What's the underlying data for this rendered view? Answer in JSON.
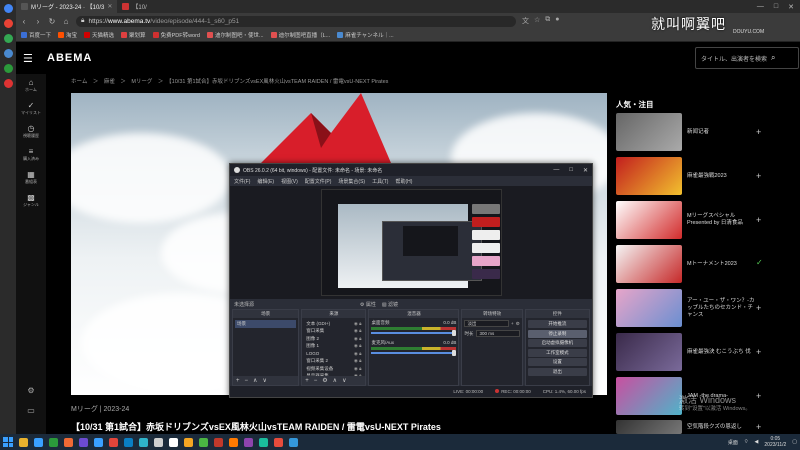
{
  "browser": {
    "tabs": [
      {
        "title": "Mリーグ - 2023-24 · 【10/3",
        "active": true,
        "favicon_color": "#333333"
      },
      {
        "title": "【10/",
        "active": false,
        "favicon_color": "#cc3333"
      }
    ],
    "url": {
      "scheme": "https://",
      "host": "www.abema.tv",
      "path": "/video/episode/444-1_s60_p51"
    },
    "window_controls": [
      "—",
      "□",
      "✕"
    ],
    "bookmarks": [
      {
        "label": "百度一下",
        "color": "#3b6fd6"
      },
      {
        "label": "淘宝",
        "color": "#ff5000"
      },
      {
        "label": "天猫精选",
        "color": "#d00000"
      },
      {
        "label": "聚划算",
        "color": "#e04040"
      },
      {
        "label": "免费PDF转word",
        "color": "#d03030"
      },
      {
        "label": "迪尔制图吧・使世...",
        "color": "#e05050"
      },
      {
        "label": "迪尔制图吧直播（L...",
        "color": "#e05050"
      },
      {
        "label": "麻雀チャンネル｜...",
        "color": "#4a8ad0"
      }
    ]
  },
  "watermark": {
    "text": "就叫啊翼吧",
    "sub": "DOUYU.COM"
  },
  "abema": {
    "logo": "ABEMA",
    "search_placeholder": "タイトル、出演者を検索",
    "rail": [
      {
        "icon": "home-icon",
        "glyph": "⌂",
        "label": "ホーム"
      },
      {
        "icon": "check-icon",
        "glyph": "✓",
        "label": "マイリスト"
      },
      {
        "icon": "history-icon",
        "glyph": "◷",
        "label": "視聴履歴"
      },
      {
        "icon": "list-icon",
        "glyph": "≡",
        "label": "購入済み"
      },
      {
        "icon": "calendar-icon",
        "glyph": "▦",
        "label": "番組表"
      },
      {
        "icon": "grid-icon",
        "glyph": "▩",
        "label": "ジャンル"
      }
    ],
    "rail_bottom": [
      {
        "icon": "settings-icon",
        "glyph": "⚙"
      },
      {
        "icon": "panel-icon",
        "glyph": "▭"
      }
    ],
    "breadcrumb": "ホーム　＞　麻雀　＞　Mリーグ　＞　【10/31 第1試合】赤坂ドリブンズvsEX風林火山vsTEAM RAIDEN / 雷電vsU-NEXT Pirates",
    "episode_meta": "Mリーグ | 2023-24",
    "episode_title": "【10/31 第1試合】赤坂ドリブンズvsEX風林火山vsTEAM RAIDEN / 雷電vsU-NEXT Pirates",
    "popular_title": "人気・注目",
    "popular": [
      {
        "label": "新闻记者",
        "action": "+",
        "thumb": [
          "#666666",
          "#aaaaaa"
        ]
      },
      {
        "label": "麻雀最強戦2023",
        "action": "+",
        "thumb": [
          "#c21e1e",
          "#f2c12e"
        ]
      },
      {
        "label": "Mリーグスペシャル Presented by 日清食品",
        "action": "+",
        "thumb": [
          "#ffffff",
          "#d22b2b"
        ]
      },
      {
        "label": "Mトーナメント2023",
        "action": "✓",
        "thumb": [
          "#f5f5f5",
          "#c62828"
        ]
      },
      {
        "label": "アー・ユー・ザ・ワン？-カップルたちのセカンド・チャンス",
        "action": "+",
        "thumb": [
          "#e7a5c9",
          "#6a8fd1"
        ]
      },
      {
        "label": "麻雀最強決 むこうぶち 伐",
        "action": "+",
        "thumb": [
          "#3a2a4a",
          "#7a6a9a"
        ]
      },
      {
        "label": "JAM -the drama-",
        "action": "+",
        "thumb": [
          "#c94fa0",
          "#4fb3c9"
        ]
      },
      {
        "label": "空気階段クズの恩返し",
        "action": "+",
        "thumb": [
          "#333333",
          "#777777"
        ]
      }
    ]
  },
  "obs": {
    "title": "OBS 26.0.2 (64 bit, windows) - 配置文件: 未命名 - 场景: 未命名",
    "menu": [
      "文件(F)",
      "编辑(E)",
      "视图(V)",
      "配置文件(P)",
      "场景集合(S)",
      "工具(T)",
      "帮助(H)"
    ],
    "status_row": [
      "未选择源",
      "⚙ 属性",
      "▧ 滤镜"
    ],
    "docks": {
      "scenes": {
        "title": "场景",
        "items": [
          "场景"
        ]
      },
      "sources": {
        "title": "来源",
        "items": [
          "文本 (GDI+)",
          "窗口采集",
          "图像 2",
          "图像 1",
          "LOGO",
          "窗口采集 2",
          "视频采集设备",
          "显示器采集"
        ]
      },
      "mixer": {
        "title": "混音器",
        "items": [
          {
            "name": "桌面音频",
            "db": "0.0 dB"
          },
          {
            "name": "麦克风/Aux",
            "db": "0.0 dB"
          }
        ]
      },
      "transitions": {
        "title": "转场特效",
        "type": "淡出",
        "duration_label": "时长",
        "duration": "300 ms"
      },
      "controls": {
        "title": "控件",
        "buttons": [
          "开始推流",
          "停止录制",
          "启动虚拟摄像机",
          "工作室模式",
          "设置",
          "退出"
        ],
        "active_index": 1
      }
    },
    "statusbar": [
      "LIVE: 00:00:00",
      "REC: 00:00:00",
      "CPU: 1.4%, 60.00 fps"
    ]
  },
  "windows": {
    "activate_title": "激活 Windows",
    "activate_sub": "转到\"设置\"以激活 Windows。"
  },
  "taskbar": {
    "icons": [
      "#e8b22e",
      "#3aa0ff",
      "#2b9a3b",
      "#f06a35",
      "#6b4bd1",
      "#3aa0ff",
      "#e2453a",
      "#0a7ec2",
      "#2fb3c9",
      "#cfcfcf",
      "#ffffff",
      "#f5a623",
      "#4bb543",
      "#c0392b",
      "#ff7a00",
      "#8e44ad",
      "#1abc9c",
      "#e74c3c",
      "#3498db"
    ],
    "tray_label": "桌面",
    "time": "0:05",
    "date": "2023/11/2"
  }
}
